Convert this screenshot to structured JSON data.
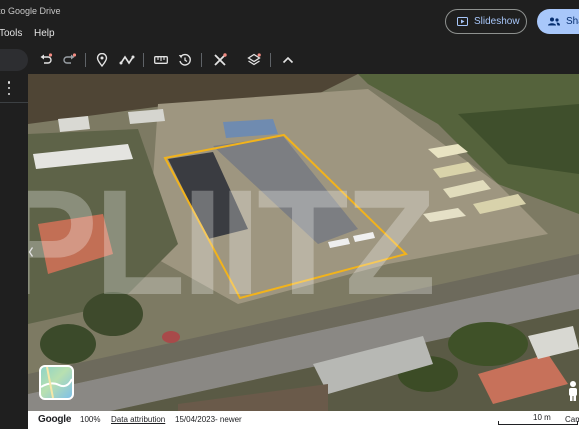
{
  "header": {
    "save_text": "to Google Drive",
    "menu": [
      "Tools",
      "Help"
    ],
    "slideshow_label": "Slideshow",
    "share_label": "Sha"
  },
  "toolbar": {
    "icons": [
      "undo-icon",
      "redo-icon",
      "placemark-icon",
      "path-icon",
      "measure-icon",
      "historical-imagery-icon",
      "tools-icon",
      "layers-icon",
      "collapse-icon"
    ]
  },
  "map": {
    "watermark": "PLIITZ",
    "thumbnail_label": "Map style"
  },
  "status": {
    "logo": "Google",
    "zoom": "100%",
    "attribution": "Data attribution",
    "date": "15/04/2023- newer",
    "scale": "10 m",
    "camera": "Cam"
  },
  "colors": {
    "share_bg": "#a8c7fa",
    "slideshow_text": "#a8c7fa",
    "outline": "#f2b31b"
  }
}
